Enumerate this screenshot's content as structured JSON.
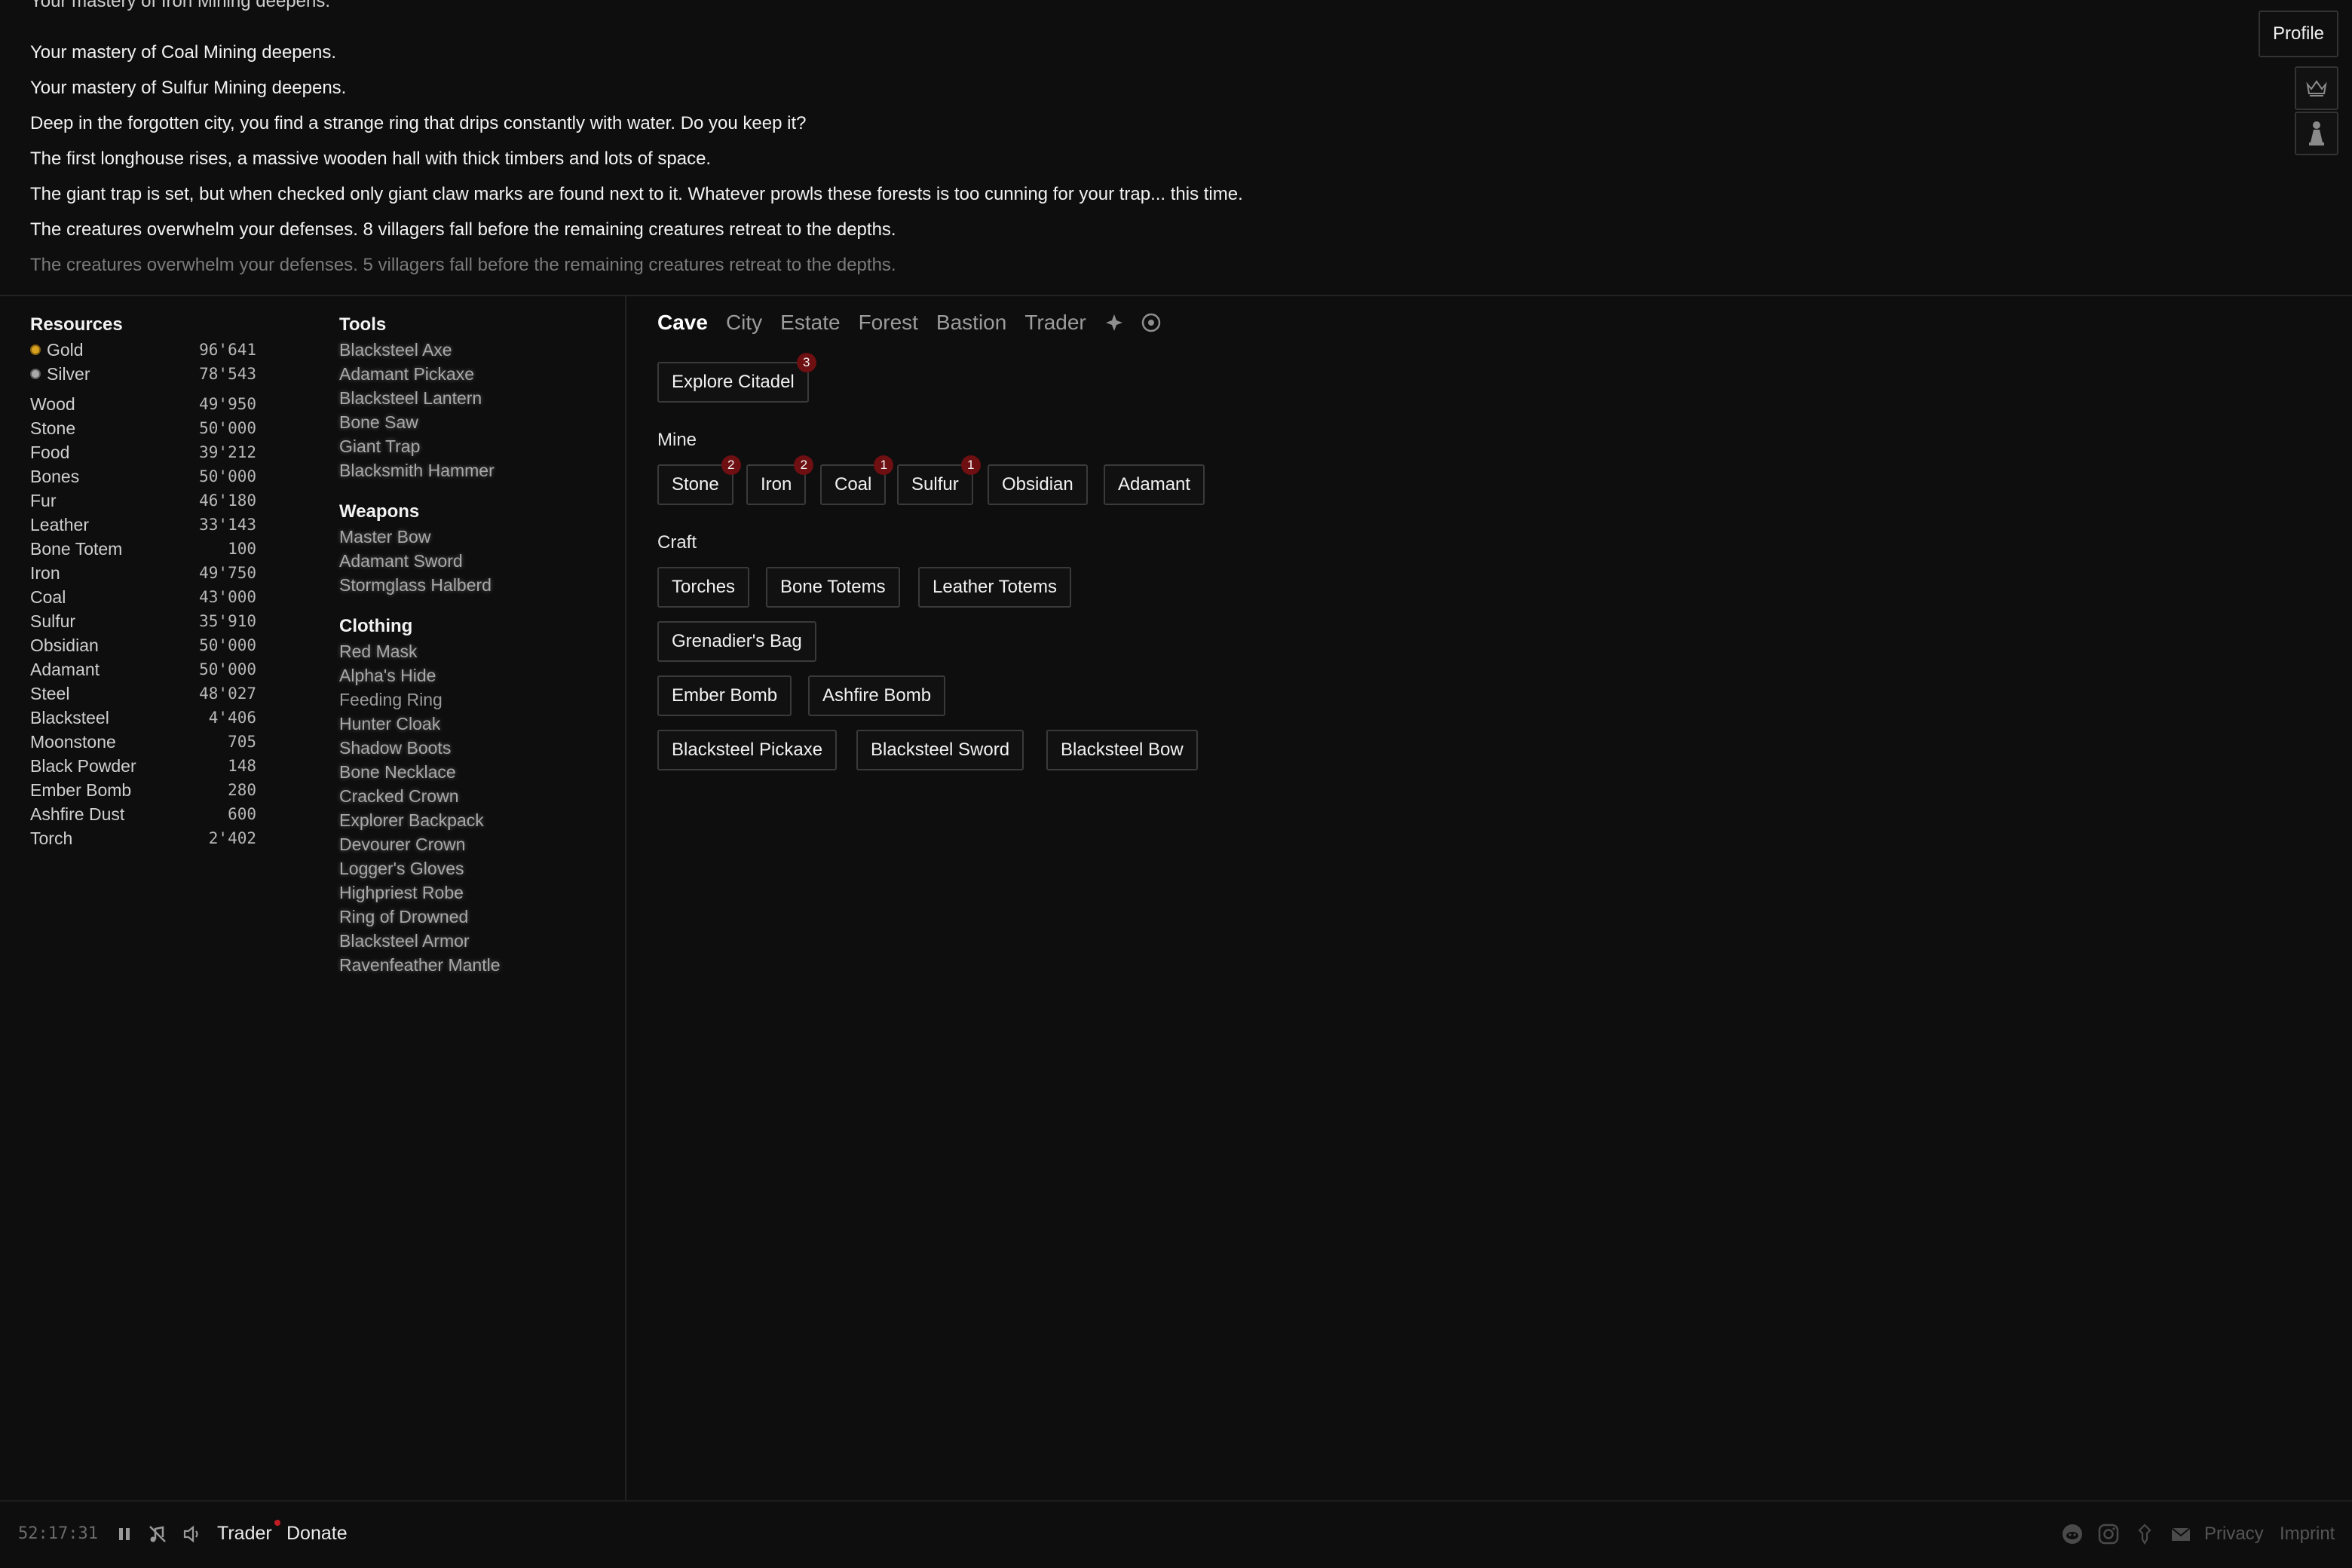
{
  "log": {
    "cut_line": "Your mastery of Iron Mining deepens.",
    "lines": [
      "Your mastery of Coal Mining deepens.",
      "Your mastery of Sulfur Mining deepens.",
      "Deep in the forgotten city, you find a strange ring that drips constantly with water. Do you keep it?",
      "The first longhouse rises, a massive wooden hall with thick timbers and lots of space.",
      "The giant trap is set, but when checked only giant claw marks are found next to it. Whatever prowls these forests is too cunning for your trap... this time.",
      "The creatures overwhelm your defenses. 8 villagers fall before the remaining creatures retreat to the depths."
    ],
    "faded_line": "The creatures overwhelm your defenses. 5 villagers fall before the remaining creatures retreat to the depths."
  },
  "header": {
    "profile_label": "Profile",
    "icons": [
      "crown-icon",
      "pawn-icon"
    ]
  },
  "resources": {
    "title": "Resources",
    "currency": [
      {
        "name": "Gold",
        "value": "96'641",
        "color": "#d9a320"
      },
      {
        "name": "Silver",
        "value": "78'543",
        "color": "#a9a9a9"
      }
    ],
    "items": [
      {
        "name": "Wood",
        "value": "49'950"
      },
      {
        "name": "Stone",
        "value": "50'000"
      },
      {
        "name": "Food",
        "value": "39'212"
      },
      {
        "name": "Bones",
        "value": "50'000"
      },
      {
        "name": "Fur",
        "value": "46'180"
      },
      {
        "name": "Leather",
        "value": "33'143"
      },
      {
        "name": "Bone Totem",
        "value": "100"
      },
      {
        "name": "Iron",
        "value": "49'750"
      },
      {
        "name": "Coal",
        "value": "43'000"
      },
      {
        "name": "Sulfur",
        "value": "35'910"
      },
      {
        "name": "Obsidian",
        "value": "50'000"
      },
      {
        "name": "Adamant",
        "value": "50'000"
      },
      {
        "name": "Steel",
        "value": "48'027"
      },
      {
        "name": "Blacksteel",
        "value": "4'406"
      },
      {
        "name": "Moonstone",
        "value": "705"
      },
      {
        "name": "Black Powder",
        "value": "148"
      },
      {
        "name": "Ember Bomb",
        "value": "280"
      },
      {
        "name": "Ashfire Dust",
        "value": "600"
      },
      {
        "name": "Torch",
        "value": "2'402"
      }
    ]
  },
  "equipment": {
    "tools_title": "Tools",
    "tools": [
      "Blacksteel Axe",
      "Adamant Pickaxe",
      "Blacksteel Lantern",
      "Bone Saw",
      "Giant Trap",
      "Blacksmith Hammer"
    ],
    "weapons_title": "Weapons",
    "weapons": [
      "Master Bow",
      "Adamant Sword",
      "Stormglass Halberd"
    ],
    "clothing_title": "Clothing",
    "clothing": [
      "Red Mask",
      "Alpha's Hide",
      "Feeding Ring",
      "Hunter Cloak",
      "Shadow Boots",
      "Bone Necklace",
      "Cracked Crown",
      "Explorer Backpack",
      "Devourer Crown",
      "Logger's Gloves",
      "Highpriest Robe",
      "Ring of Drowned",
      "Blacksteel Armor",
      "Ravenfeather Mantle"
    ]
  },
  "tabs": {
    "items": [
      "Cave",
      "City",
      "Estate",
      "Forest",
      "Bastion",
      "Trader"
    ],
    "active": "Cave",
    "icons": [
      "compass-icon",
      "target-icon"
    ]
  },
  "cave": {
    "explore": {
      "label": "Explore Citadel",
      "badge": "3"
    },
    "mine_title": "Mine",
    "mine": [
      {
        "label": "Stone",
        "badge": "2"
      },
      {
        "label": "Iron",
        "badge": "2"
      },
      {
        "label": "Coal",
        "badge": "1"
      },
      {
        "label": "Sulfur",
        "badge": "1"
      },
      {
        "label": "Obsidian"
      },
      {
        "label": "Adamant"
      }
    ],
    "craft_title": "Craft",
    "craft_rows": [
      [
        "Torches",
        "Bone Totems",
        "Leather Totems"
      ],
      [
        "Grenadier's Bag"
      ],
      [
        "Ember Bomb",
        "Ashfire Bomb"
      ],
      [
        "Blacksteel Pickaxe",
        "Blacksteel Sword",
        "Blacksteel Bow"
      ]
    ]
  },
  "footer": {
    "timer": "52:17:31",
    "trader_label": "Trader",
    "donate_label": "Donate",
    "privacy_label": "Privacy",
    "imprint_label": "Imprint",
    "icons": [
      "pause-icon",
      "no-music-icon",
      "volume-icon",
      "reddit-icon",
      "instagram-icon",
      "pin-icon",
      "mail-icon"
    ]
  }
}
